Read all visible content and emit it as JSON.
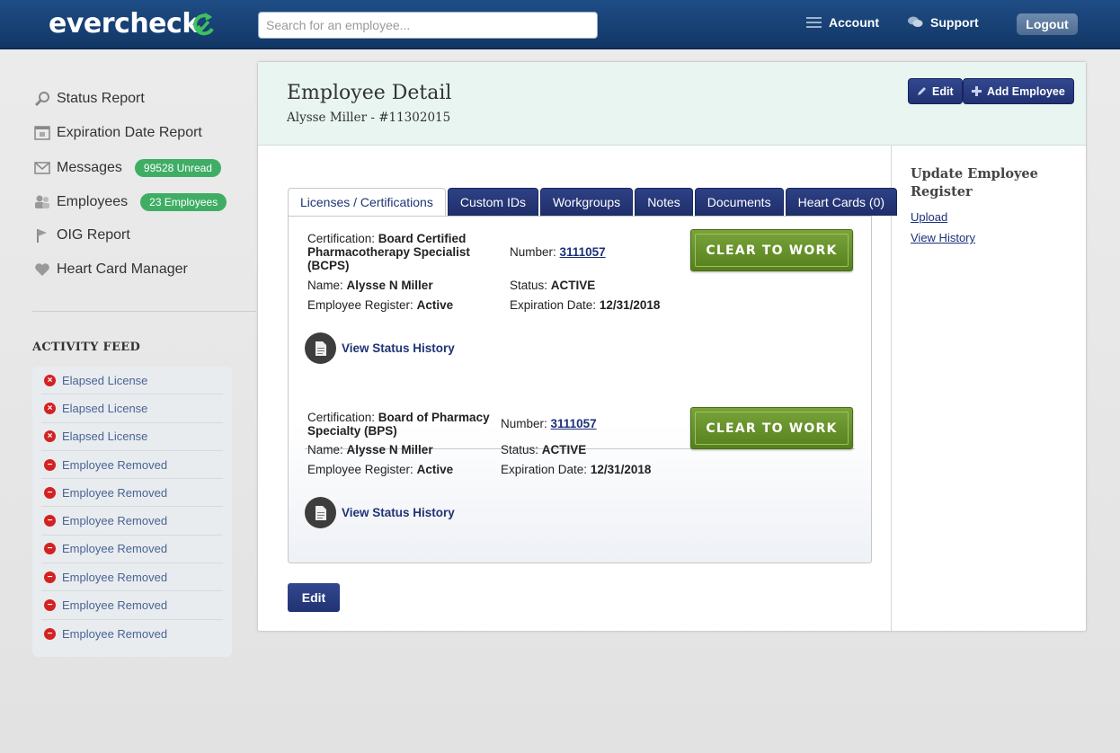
{
  "header": {
    "logo_text": "evercheck",
    "search_placeholder": "Search for an employee...",
    "account_label": "Account",
    "support_label": "Support",
    "logout_label": "Logout"
  },
  "sidebar": {
    "items": [
      {
        "label": "Status Report",
        "icon": "magnifier-icon"
      },
      {
        "label": "Expiration Date Report",
        "icon": "calendar-icon"
      },
      {
        "label": "Messages",
        "icon": "envelope-icon",
        "badge": "99528 Unread"
      },
      {
        "label": "Employees",
        "icon": "people-icon",
        "badge": "23 Employees"
      },
      {
        "label": "OIG Report",
        "icon": "flag-icon"
      },
      {
        "label": "Heart Card Manager",
        "icon": "heart-icon"
      }
    ],
    "activity_title": "ACTIVITY FEED",
    "feed": [
      {
        "label": "Elapsed License",
        "type": "error"
      },
      {
        "label": "Elapsed License",
        "type": "error"
      },
      {
        "label": "Elapsed License",
        "type": "error"
      },
      {
        "label": "Employee Removed",
        "type": "removed"
      },
      {
        "label": "Employee Removed",
        "type": "removed"
      },
      {
        "label": "Employee Removed",
        "type": "removed"
      },
      {
        "label": "Employee Removed",
        "type": "removed"
      },
      {
        "label": "Employee Removed",
        "type": "removed"
      },
      {
        "label": "Employee Removed",
        "type": "removed"
      },
      {
        "label": "Employee Removed",
        "type": "removed"
      }
    ]
  },
  "main": {
    "title": "Employee Detail",
    "subtitle": "Alysse Miller - #11302015",
    "edit_label": "Edit",
    "add_employee_label": "Add Employee",
    "tabs": [
      "Licenses / Certifications",
      "Custom IDs",
      "Workgroups",
      "Notes",
      "Documents",
      "Heart Cards (0)"
    ],
    "certs": [
      {
        "cert_label": "Certification:",
        "cert_value": "Board Certified Pharmacotherapy Specialist (BCPS)",
        "number_label": "Number:",
        "number_value": "3111057",
        "name_label": "Name:",
        "name_value": "Alysse N Miller",
        "status_label": "Status:",
        "status_value": "ACTIVE",
        "register_label": "Employee Register:",
        "register_value": "Active",
        "exp_label": "Expiration Date:",
        "exp_value": "12/31/2018",
        "badge": "CLEAR TO WORK",
        "history_label": "View Status History"
      },
      {
        "cert_label": "Certification:",
        "cert_value": "Board of Pharmacy Specialty (BPS)",
        "number_label": "Number:",
        "number_value": "3111057",
        "name_label": "Name:",
        "name_value": "Alysse N Miller",
        "status_label": "Status:",
        "status_value": "ACTIVE",
        "register_label": "Employee Register:",
        "register_value": "Active",
        "exp_label": "Expiration Date:",
        "exp_value": "12/31/2018",
        "badge": "CLEAR TO WORK",
        "history_label": "View Status History"
      }
    ],
    "bottom_edit_label": "Edit"
  },
  "right_panel": {
    "title": "Update Employee Register",
    "upload_label": "Upload",
    "history_label": "View History"
  },
  "colors": {
    "header_bg": "#1a4479",
    "accent_navy": "#203272",
    "badge_green": "#3fae64",
    "clear_to_work_green": "#6a952c",
    "error_red": "#d42121"
  }
}
